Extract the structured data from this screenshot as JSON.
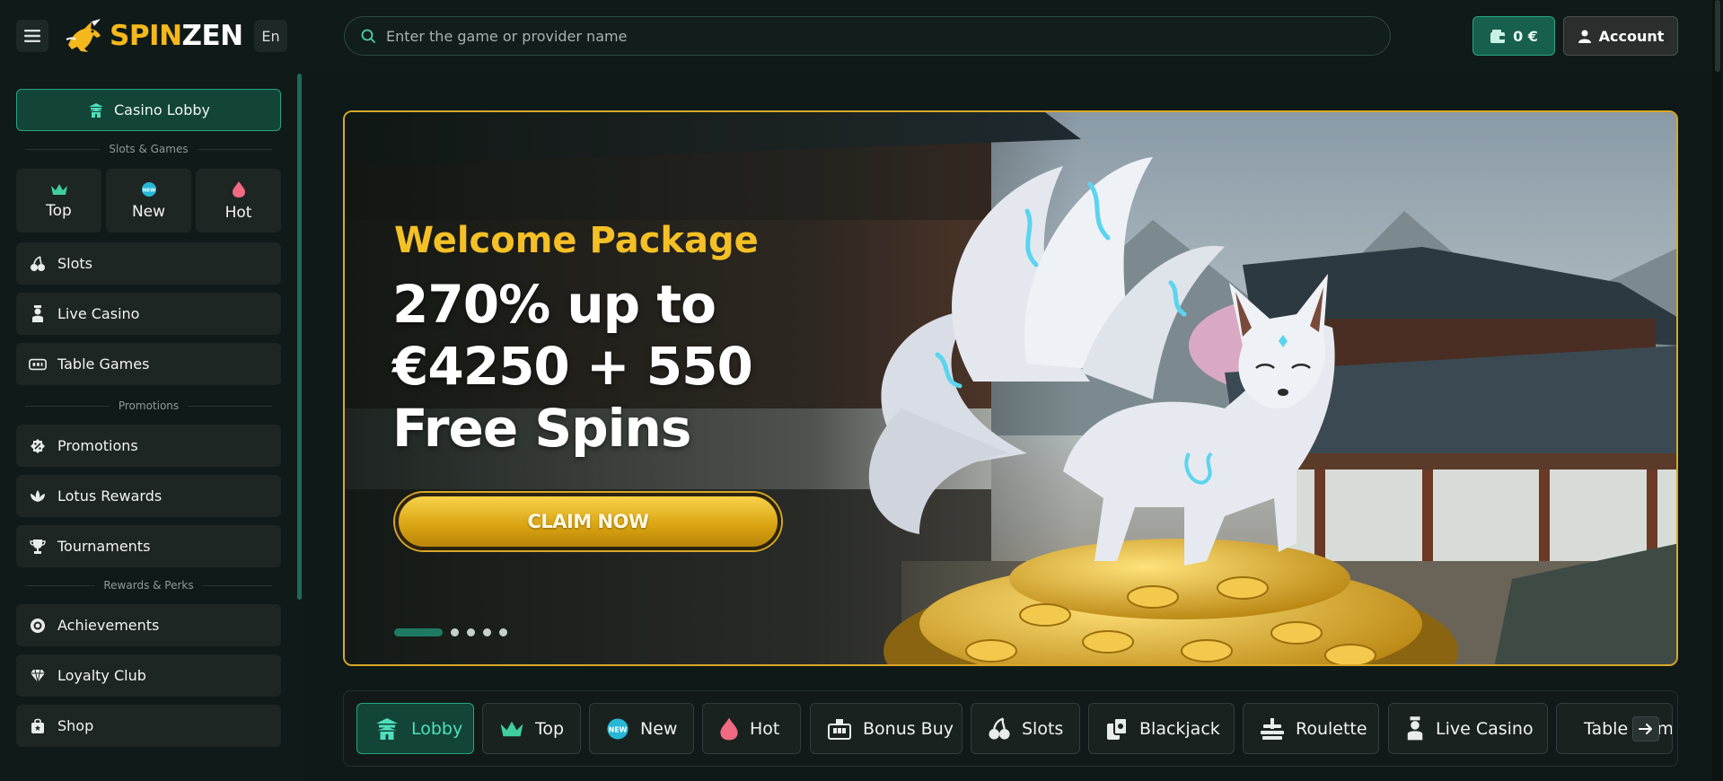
{
  "header": {
    "language": "En",
    "logo": {
      "part1": "SPIN",
      "part2": "ZEN"
    },
    "search_placeholder": "Enter the game or provider name",
    "balance": "0 €",
    "account_label": "Account"
  },
  "sidebar": {
    "lobby_label": "Casino Lobby",
    "section_slots": "Slots & Games",
    "tiles": [
      {
        "label": "Top",
        "icon": "crown-icon"
      },
      {
        "label": "New",
        "icon": "new-badge-icon"
      },
      {
        "label": "Hot",
        "icon": "fire-icon"
      }
    ],
    "games": [
      {
        "label": "Slots",
        "icon": "cherries-icon"
      },
      {
        "label": "Live Casino",
        "icon": "dealer-icon"
      },
      {
        "label": "Table Games",
        "icon": "table-icon"
      }
    ],
    "section_promotions": "Promotions",
    "promotions": [
      {
        "label": "Promotions",
        "icon": "percent-icon"
      },
      {
        "label": "Lotus Rewards",
        "icon": "lotus-icon"
      },
      {
        "label": "Tournaments",
        "icon": "trophy-icon"
      }
    ],
    "section_rewards": "Rewards & Perks",
    "rewards": [
      {
        "label": "Achievements",
        "icon": "medal-icon"
      },
      {
        "label": "Loyalty Club",
        "icon": "diamond-icon"
      },
      {
        "label": "Shop",
        "icon": "shop-bag-icon"
      }
    ]
  },
  "banner": {
    "welcome": "Welcome Package",
    "line1": "270% up to",
    "line2": "€4250 + 550",
    "line3": "Free Spins",
    "cta": "CLAIM NOW",
    "slides": 5,
    "active_slide": 1
  },
  "categories": [
    {
      "label": "Lobby",
      "icon": "pagoda-icon",
      "active": true
    },
    {
      "label": "Top",
      "icon": "crown-icon"
    },
    {
      "label": "New",
      "icon": "new-badge-icon"
    },
    {
      "label": "Hot",
      "icon": "fire-icon"
    },
    {
      "label": "Bonus Buy",
      "icon": "bonus-buy-icon"
    },
    {
      "label": "Slots",
      "icon": "cherries-icon"
    },
    {
      "label": "Blackjack",
      "icon": "cards-icon"
    },
    {
      "label": "Roulette",
      "icon": "roulette-icon"
    },
    {
      "label": "Live Casino",
      "icon": "dealer-icon"
    },
    {
      "label": "Table Games",
      "icon": "table-icon"
    }
  ],
  "colors": {
    "accent": "#27a485",
    "gold": "#f5b81c",
    "background": "#0f1a18"
  }
}
